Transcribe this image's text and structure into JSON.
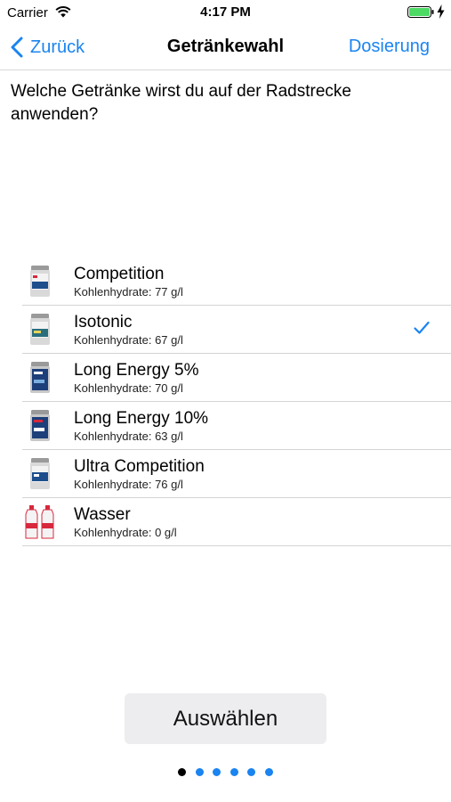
{
  "status_bar": {
    "carrier": "Carrier",
    "time": "4:17 PM",
    "battery_color": "#4cd964"
  },
  "nav": {
    "back_label": "Zurück",
    "title": "Getränkewahl",
    "right_label": "Dosierung",
    "tint": "#1a84f0"
  },
  "question": "Welche Getränke wirst du auf der Radstrecke anwenden?",
  "drinks": [
    {
      "name": "Competition",
      "carbs": "Kohlenhydrate: 77 g/l",
      "icon": "powder-can-icon",
      "selected": false
    },
    {
      "name": "Isotonic",
      "carbs": "Kohlenhydrate: 67 g/l",
      "icon": "powder-can-icon",
      "selected": true
    },
    {
      "name": "Long Energy 5%",
      "carbs": "Kohlenhydrate: 70 g/l",
      "icon": "powder-can-icon",
      "selected": false
    },
    {
      "name": "Long Energy 10%",
      "carbs": "Kohlenhydrate: 63 g/l",
      "icon": "powder-can-icon",
      "selected": false
    },
    {
      "name": "Ultra Competition",
      "carbs": "Kohlenhydrate: 76 g/l",
      "icon": "powder-can-icon",
      "selected": false
    },
    {
      "name": "Wasser",
      "carbs": "Kohlenhydrate: 0 g/l",
      "icon": "water-bottles-icon",
      "selected": false
    }
  ],
  "select_button": "Auswählen",
  "page_indicator": {
    "total": 6,
    "current": 1
  }
}
